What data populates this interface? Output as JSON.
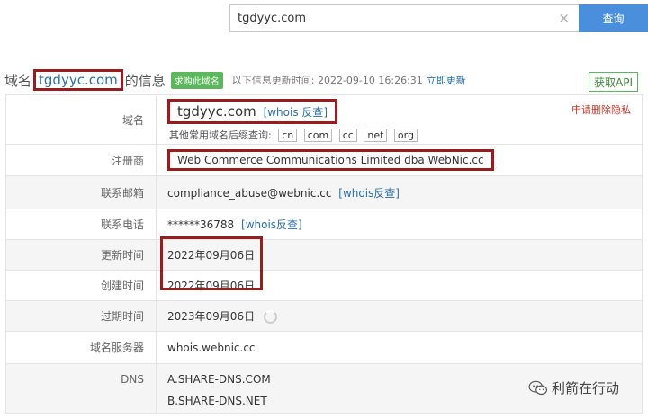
{
  "search": {
    "value": "tgdyyc.com",
    "clear_glyph": "×",
    "button_label": "查询"
  },
  "heading": {
    "prefix": "域名",
    "domain": "tgdyyc.com",
    "suffix": "的信息",
    "buy_badge": "求购此域名",
    "update_text": "以下信息更新时间: 2022-09-10 16:26:31",
    "update_link": "立即更新",
    "api_button": "获取API"
  },
  "rows": {
    "domain": {
      "label": "域名",
      "value": "tgdyyc.com",
      "whois_link": "[whois 反查]",
      "privacy_link": "申请删除隐私",
      "suffix_label": "其他常用域名后缀查询:",
      "suffixes": [
        "cn",
        "com",
        "cc",
        "net",
        "org"
      ]
    },
    "registrar": {
      "label": "注册商",
      "value": "Web Commerce Communications Limited dba WebNic.cc"
    },
    "email": {
      "label": "联系邮箱",
      "value": "compliance_abuse@webnic.cc",
      "whois_link": "[whois反查]"
    },
    "phone": {
      "label": "联系电话",
      "value": "******36788",
      "whois_link": "[whois反查]"
    },
    "updated": {
      "label": "更新时间",
      "value": "2022年09月06日"
    },
    "created": {
      "label": "创建时间",
      "value": "2022年09月06日"
    },
    "expires": {
      "label": "过期时间",
      "value": "2023年09月06日"
    },
    "nameserver": {
      "label": "域名服务器",
      "value": "whois.webnic.cc"
    },
    "dns": {
      "label": "DNS",
      "values": [
        "A.SHARE-DNS.COM",
        "B.SHARE-DNS.NET"
      ]
    }
  },
  "watermark": {
    "text": "利箭在行动",
    "icon": "wechat-icon"
  },
  "colors": {
    "accent": "#4a8fdb",
    "link": "#2a6fa8",
    "highlight_box": "#9b1c1c",
    "badge_green": "#5cb85c",
    "privacy_red": "#c0392b",
    "row_alt": "#f5f5f5"
  }
}
